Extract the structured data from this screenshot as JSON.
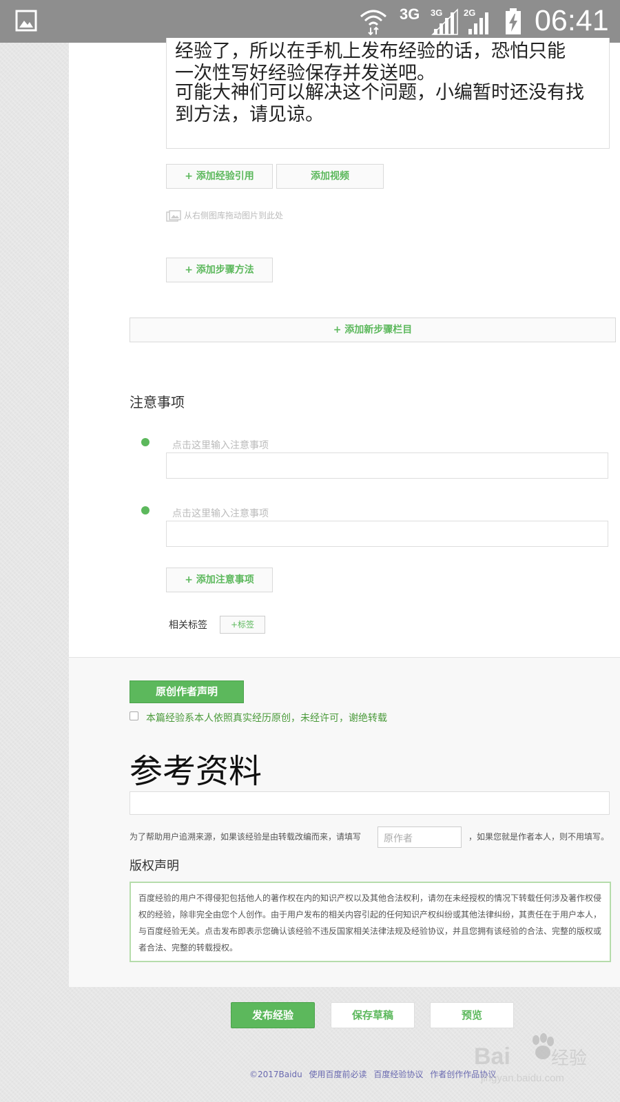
{
  "status_bar": {
    "network_a": "3G",
    "network_b": "3G",
    "network_c": "2G",
    "time": "06:41",
    "icons": [
      "gallery-icon",
      "wifi-icon",
      "signal-icon",
      "signal-icon",
      "battery-charging-icon"
    ]
  },
  "editor": {
    "text_line1": "经验了，所以在手机上发布经验的话，恐怕只能",
    "text_line1b": "一次性写好经验保存并发送吧。",
    "text_para2": "可能大神们可以解决这个问题，小编暂时还没有找到方法，请见谅。",
    "add_reference": "+ 添加经验引用",
    "add_video": "添加视频",
    "drag_hint": "从右侧图库拖动图片到此处",
    "add_step_method": "+ 添加步骤方法",
    "add_step_section": "+ 添加新步骤栏目"
  },
  "notes": {
    "title": "注意事项",
    "placeholder1": "点击这里输入注意事项",
    "placeholder2": "点击这里输入注意事项",
    "add_note": "+ 添加注意事项",
    "tags_label": "相关标签",
    "add_tag": "+标签"
  },
  "original": {
    "button": "原创作者声明",
    "checkbox_label": "本篇经验系本人依照真实经历原创，未经许可，谢绝转载",
    "checked": false
  },
  "reference": {
    "title": "参考资料",
    "source_prefix": "为了帮助用户追溯来源，如果该经验是由转载改编而来，请填写",
    "source_placeholder": "原作者",
    "source_suffix": "，如果您就是作者本人，则不用填写。"
  },
  "copyright": {
    "title": "版权声明",
    "text": "百度经验的用户不得侵犯包括他人的著作权在内的知识产权以及其他合法权利，请勿在未经授权的情况下转载任何涉及著作权侵权的经验，除非完全由您个人创作。由于用户发布的相关内容引起的任何知识产权纠纷或其他法律纠纷，其责任在于用户本人，与百度经验无关。点击发布即表示您确认该经验不违反国家相关法律法规及经验协议，并且您拥有该经验的合法、完整的版权或者合法、完整的转载授权。"
  },
  "actions": {
    "publish": "发布经验",
    "save_draft": "保存草稿",
    "preview": "预览"
  },
  "footer": {
    "copyright": "©2017Baidu",
    "link1": "使用百度前必读",
    "link2": "百度经验协议",
    "link3": "作者创作作品协议"
  },
  "watermark": {
    "brand": "Bai",
    "brand_cn": "经验",
    "url": "jingyan.baidu.com"
  },
  "colors": {
    "accent_green": "#5cb85c",
    "status_bar": "#8e8e8e"
  }
}
